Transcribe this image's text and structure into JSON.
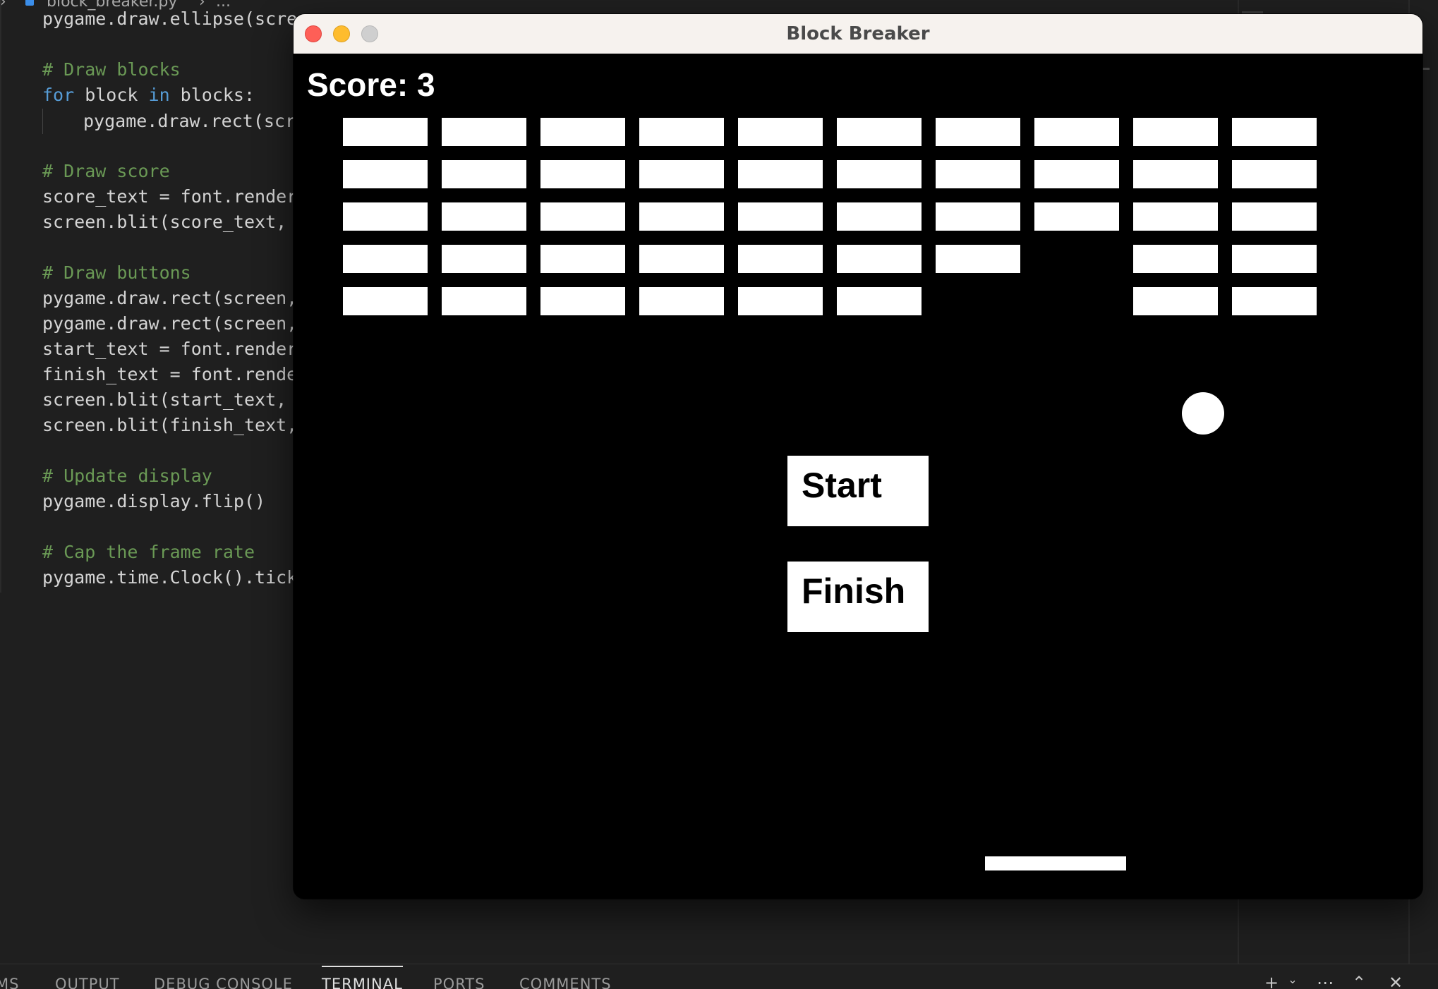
{
  "editor": {
    "breadcrumb": {
      "chevron": "›",
      "file": "block_breaker.py",
      "separator": "›",
      "ellipsis": "..."
    },
    "code_lines": [
      "pygame.draw.ellipse(scree",
      "",
      "# Draw blocks",
      "for block in blocks:",
      "pygame.draw.rect(scre",
      "",
      "# Draw score",
      "score_text = font.render(",
      "screen.blit(score_text, (",
      "",
      "# Draw buttons",
      "pygame.draw.rect(screen,",
      "pygame.draw.rect(screen,",
      "start_text = font.render(",
      "finish_text = font.render",
      "screen.blit(start_text, (",
      "screen.blit(finish_text,",
      "",
      "# Update display",
      "pygame.display.flip()",
      "",
      "# Cap the frame rate",
      "pygame.time.Clock().tick("
    ]
  },
  "panel": {
    "tabs": [
      "MS",
      "OUTPUT",
      "DEBUG CONSOLE",
      "TERMINAL",
      "PORTS",
      "COMMENTS"
    ],
    "active_tab": "TERMINAL",
    "icons": [
      "plus-icon",
      "chevron-down-icon",
      "ellipsis-icon",
      "chevron-up-icon",
      "close-icon"
    ]
  },
  "window": {
    "title": "Block Breaker",
    "controls": [
      "close",
      "minimize",
      "zoom"
    ]
  },
  "game": {
    "score_label": "Score: 3",
    "start_label": "Start",
    "finish_label": "Finish",
    "colors": {
      "background": "#000000",
      "foreground": "#ffffff"
    },
    "block_grid": {
      "rows": 5,
      "columns": 10,
      "present": [
        [
          1,
          1,
          1,
          1,
          1,
          1,
          1,
          1,
          1,
          1
        ],
        [
          1,
          1,
          1,
          1,
          1,
          1,
          1,
          1,
          1,
          1
        ],
        [
          1,
          1,
          1,
          1,
          1,
          1,
          1,
          1,
          1,
          1
        ],
        [
          1,
          1,
          1,
          1,
          1,
          1,
          1,
          0,
          1,
          1
        ],
        [
          1,
          1,
          1,
          1,
          1,
          1,
          0,
          0,
          1,
          1
        ]
      ]
    }
  }
}
